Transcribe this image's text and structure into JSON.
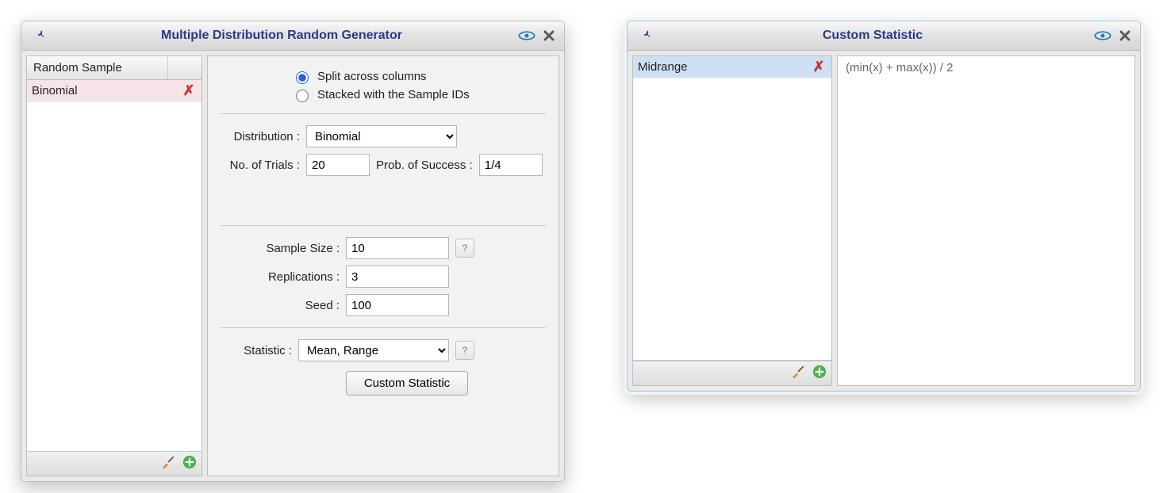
{
  "dialog1": {
    "title": "Multiple Distribution Random Generator",
    "list_header": "Random Sample",
    "rows": [
      {
        "label": "Binomial"
      }
    ],
    "radio_split": "Split across columns",
    "radio_stacked": "Stacked with the Sample IDs",
    "label_distribution": "Distribution :",
    "distribution_value": "Binomial",
    "label_trials": "No. of Trials :",
    "trials_value": "20",
    "label_prob": "Prob. of Success :",
    "prob_value": "1/4",
    "label_sample_size": "Sample Size :",
    "sample_size_value": "10",
    "label_replications": "Replications :",
    "replications_value": "3",
    "label_seed": "Seed :",
    "seed_value": "100",
    "label_statistic": "Statistic :",
    "statistic_value": "Mean, Range",
    "help_glyph": "?",
    "btn_custom": "Custom Statistic"
  },
  "dialog2": {
    "title": "Custom Statistic",
    "rows": [
      {
        "label": "Midrange"
      }
    ],
    "expression": "(min(x) + max(x)) / 2"
  }
}
